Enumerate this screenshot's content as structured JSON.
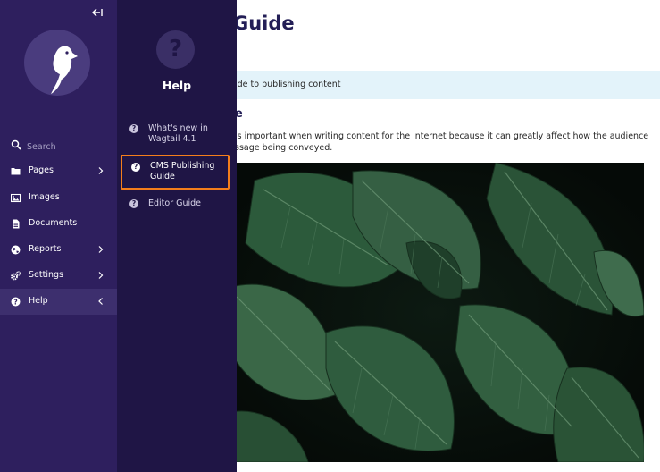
{
  "main": {
    "page_title": "Guide",
    "help_text": "ide to publishing content",
    "section_heading": "e",
    "paragraph_line1": "is important when writing content for the internet because it can greatly affect how the audience",
    "paragraph_line2": "ssage being conveyed.",
    "image": {
      "subject": "monstera leaves",
      "colors": {
        "leaf": "#2f5c3e",
        "leaf_light": "#4d7a5a",
        "background": "#070d0a"
      }
    }
  },
  "sidebar": {
    "collapse_icon": "collapse-left-icon",
    "logo": "wagtail-logo",
    "search": {
      "placeholder": "Search",
      "value": ""
    },
    "items": [
      {
        "label": "Pages",
        "icon": "folder-icon",
        "has_chevron": true
      },
      {
        "label": "Images",
        "icon": "image-icon",
        "has_chevron": false
      },
      {
        "label": "Documents",
        "icon": "document-icon",
        "has_chevron": false
      },
      {
        "label": "Reports",
        "icon": "globe-icon",
        "has_chevron": true
      },
      {
        "label": "Settings",
        "icon": "cogs-icon",
        "has_chevron": true
      },
      {
        "label": "Help",
        "icon": "help-icon",
        "has_chevron": true,
        "active": true
      }
    ]
  },
  "submenu": {
    "icon": "?",
    "title": "Help",
    "items": [
      {
        "label": "What's new in Wagtail 4.1"
      },
      {
        "label": "CMS Publishing Guide",
        "focused": true
      },
      {
        "label": "Editor Guide"
      }
    ]
  },
  "colors": {
    "sidebar_bg": "#2e1f5e",
    "submenu_bg": "#1f1545",
    "title_color": "#231e56",
    "help_block_bg": "#e3f3fa",
    "focus_outline": "#f47e1b"
  }
}
